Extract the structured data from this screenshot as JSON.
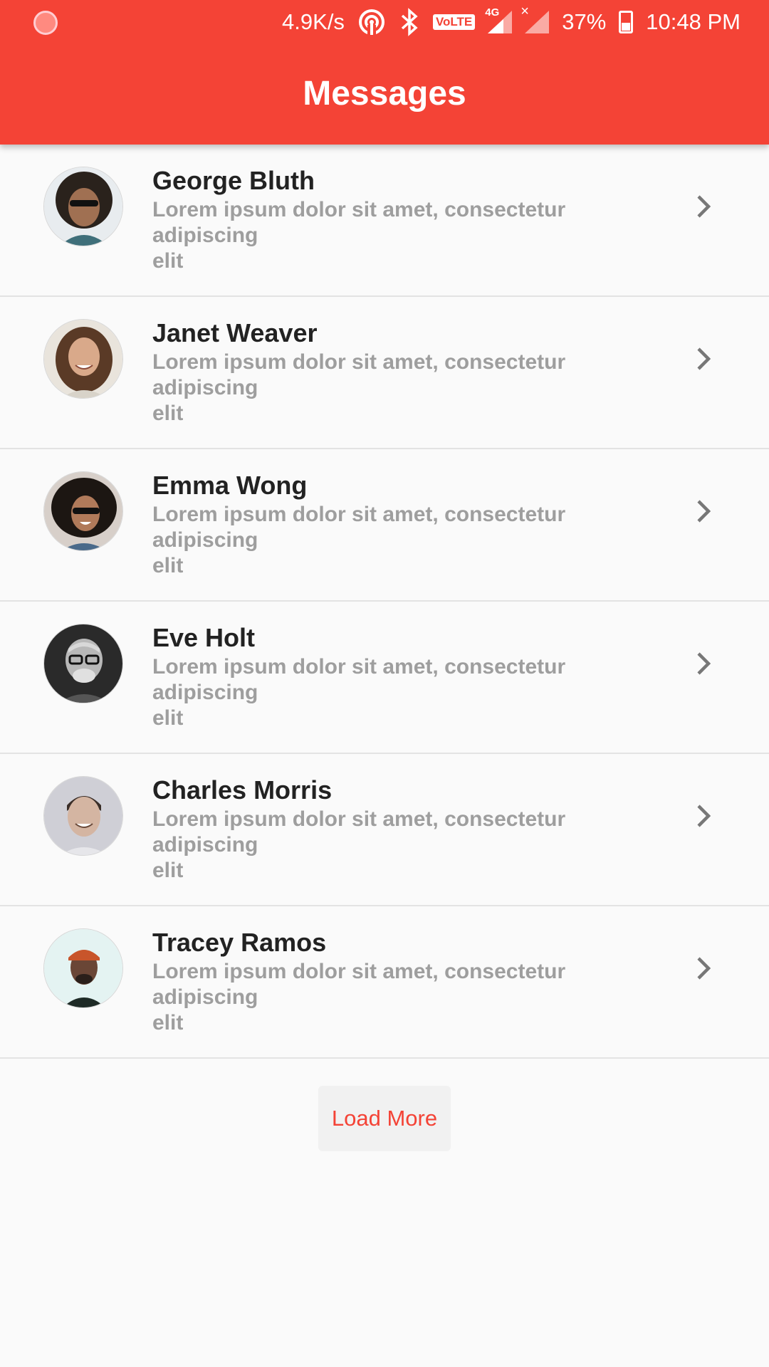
{
  "status_bar": {
    "network_speed": "4.9K/s",
    "volte_label": "VoLTE",
    "network_type": "4G",
    "battery_percent": "37%",
    "time": "10:48 PM",
    "icons": [
      "notification-icon",
      "hotspot-icon",
      "bluetooth-icon",
      "volte-icon",
      "signal-icon",
      "no-signal-icon",
      "battery-charging-icon"
    ]
  },
  "app_bar": {
    "title": "Messages",
    "color": "#f44336"
  },
  "messages": [
    {
      "name": "George Bluth",
      "preview_line1": "Lorem ipsum dolor sit amet, consectetur adipiscing",
      "preview_line2": "elit"
    },
    {
      "name": "Janet Weaver",
      "preview_line1": "Lorem ipsum dolor sit amet, consectetur adipiscing",
      "preview_line2": "elit"
    },
    {
      "name": "Emma Wong",
      "preview_line1": "Lorem ipsum dolor sit amet, consectetur adipiscing",
      "preview_line2": "elit"
    },
    {
      "name": "Eve Holt",
      "preview_line1": "Lorem ipsum dolor sit amet, consectetur adipiscing",
      "preview_line2": "elit"
    },
    {
      "name": "Charles Morris",
      "preview_line1": "Lorem ipsum dolor sit amet, consectetur adipiscing",
      "preview_line2": "elit"
    },
    {
      "name": "Tracey Ramos",
      "preview_line1": "Lorem ipsum dolor sit amet, consectetur adipiscing",
      "preview_line2": "elit"
    }
  ],
  "load_more_label": "Load More"
}
